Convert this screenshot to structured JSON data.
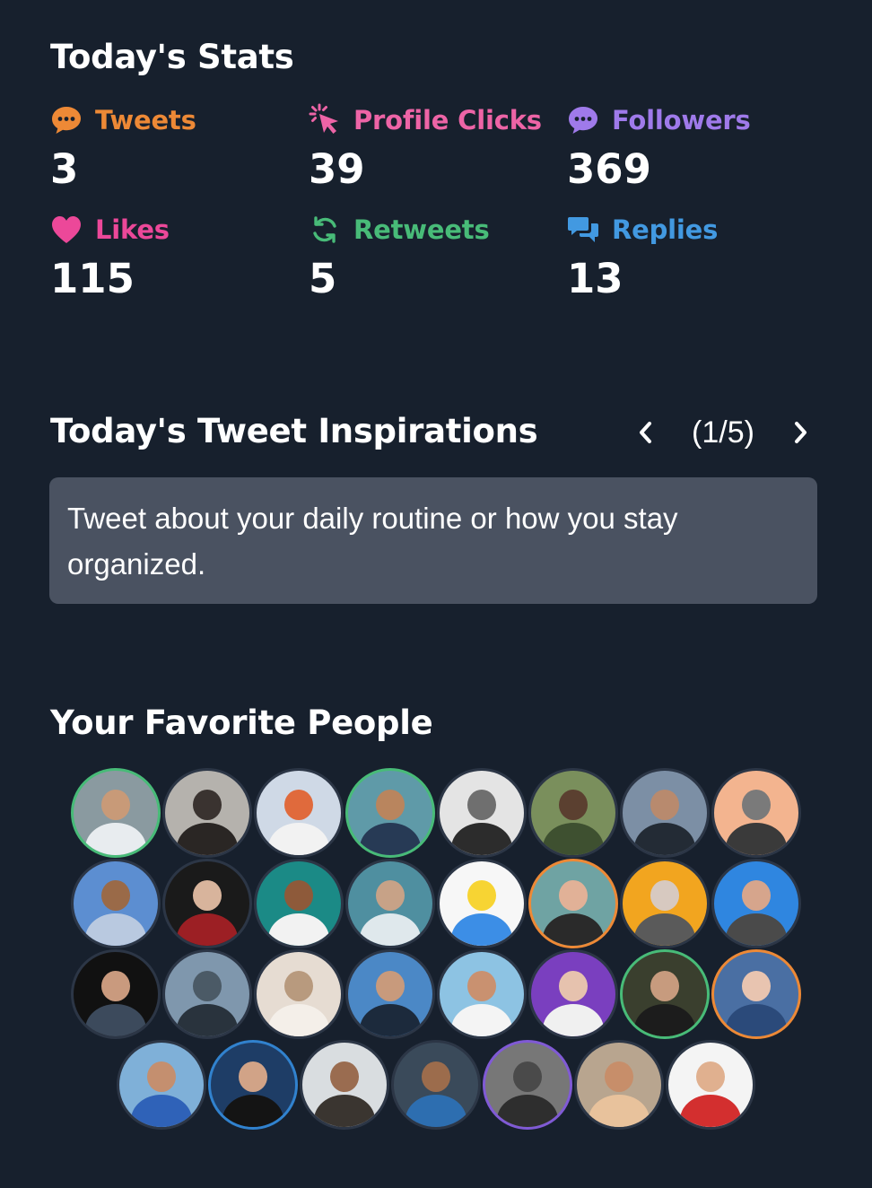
{
  "stats": {
    "title": "Today's Stats",
    "items": [
      {
        "label": "Tweets",
        "value": "3",
        "color": "#ed8936",
        "icon": "chat-bubble-icon"
      },
      {
        "label": "Profile Clicks",
        "value": "39",
        "color": "#ed64a6",
        "icon": "cursor-click-icon"
      },
      {
        "label": "Followers",
        "value": "369",
        "color": "#9f7aea",
        "icon": "chat-bubble-icon"
      },
      {
        "label": "Likes",
        "value": "115",
        "color": "#ec4899",
        "icon": "heart-icon"
      },
      {
        "label": "Retweets",
        "value": "5",
        "color": "#48bb78",
        "icon": "retweet-icon"
      },
      {
        "label": "Replies",
        "value": "13",
        "color": "#4299e1",
        "icon": "replies-icon"
      }
    ]
  },
  "inspirations": {
    "title": "Today's Tweet Inspirations",
    "counter": "(1/5)",
    "text": "Tweet about your daily routine or how you stay organized."
  },
  "favorites": {
    "title": "Your Favorite People",
    "ring_colors": {
      "green": "#48bb78",
      "orange": "#ed8936",
      "purple": "#805ad5",
      "blue": "#3182ce",
      "none": "#2c3646"
    }
  }
}
